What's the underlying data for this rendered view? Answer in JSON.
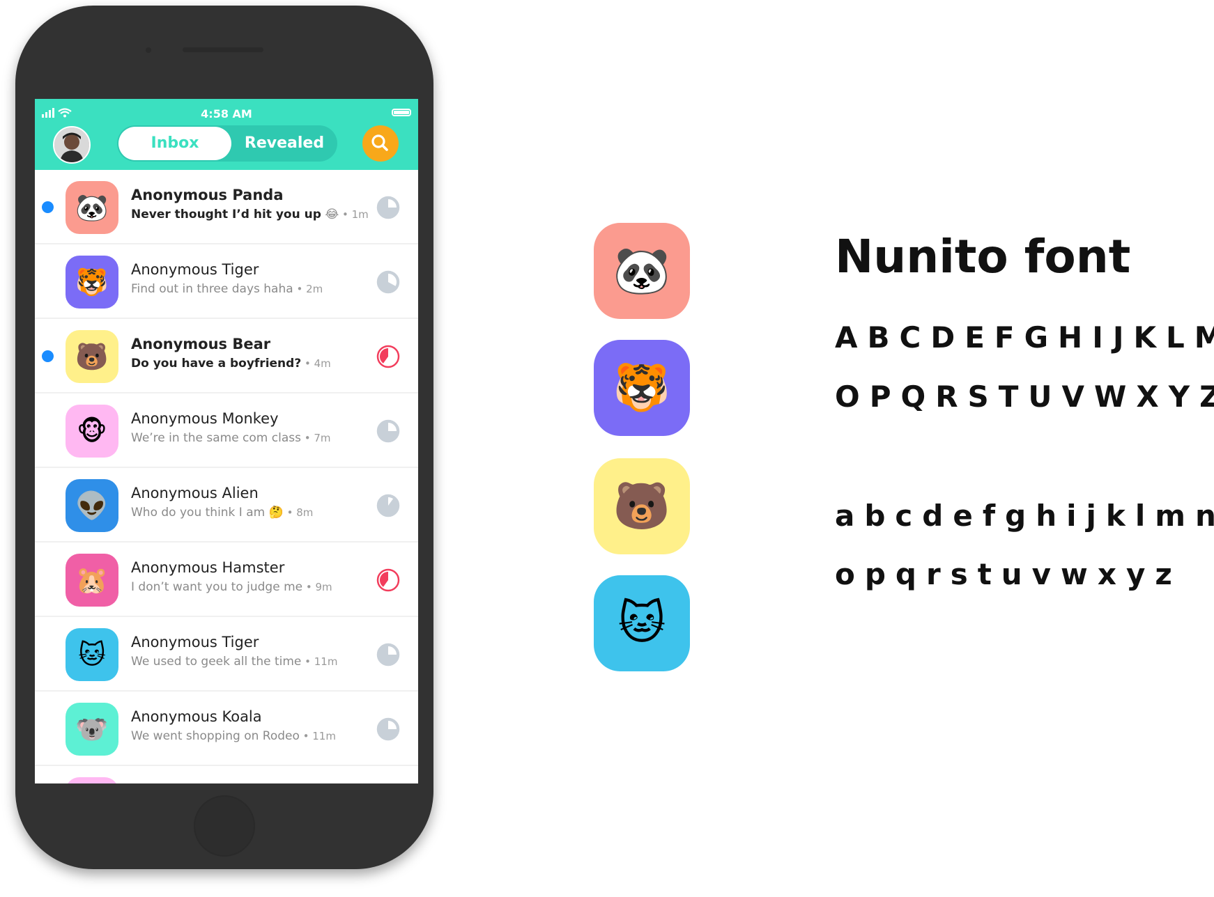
{
  "status_bar": {
    "time": "4:58 AM"
  },
  "header": {
    "tabs": {
      "inbox": "Inbox",
      "revealed": "Revealed"
    }
  },
  "messages": [
    {
      "name": "Anonymous Panda",
      "message": "Never thought I’d hit you up",
      "emoji": "😂",
      "time": "1m",
      "unread": true,
      "icon": "🐼",
      "icon_bg": "#fb9b8f",
      "timer_color": "#c8d0d8",
      "timer_fraction": 0.25
    },
    {
      "name": "Anonymous Tiger",
      "message": "Find out in three days haha",
      "emoji": "",
      "time": "2m",
      "unread": false,
      "icon": "🐯",
      "icon_bg": "#7b6cf6",
      "timer_color": "#c8d0d8",
      "timer_fraction": 0.33
    },
    {
      "name": "Anonymous Bear",
      "message": "Do you have a boyfriend?",
      "emoji": "",
      "time": "4m",
      "unread": true,
      "icon": "🐻",
      "icon_bg": "#fff08a",
      "timer_color": "#f23d5c",
      "timer_fraction": 0.6
    },
    {
      "name": "Anonymous Monkey",
      "message": "We’re in the same com class",
      "emoji": "",
      "time": "7m",
      "unread": false,
      "icon": "🐵",
      "icon_bg": "#ffb8f2",
      "timer_color": "#c8d0d8",
      "timer_fraction": 0.25
    },
    {
      "name": "Anonymous Alien",
      "message": "Who do you think I am",
      "emoji": "🤔",
      "time": "8m",
      "unread": false,
      "icon": "👽",
      "icon_bg": "#2f8fe8",
      "timer_color": "#c8d0d8",
      "timer_fraction": 0.1
    },
    {
      "name": "Anonymous Hamster",
      "message": "I don’t want you to judge me",
      "emoji": "",
      "time": "9m",
      "unread": false,
      "icon": "🐹",
      "icon_bg": "#f05fa6",
      "timer_color": "#f23d5c",
      "timer_fraction": 0.6
    },
    {
      "name": "Anonymous Tiger",
      "message": "We used to geek all the time",
      "emoji": "",
      "time": "11m",
      "unread": false,
      "icon": "🐱",
      "icon_bg": "#3ec3ec",
      "timer_color": "#c8d0d8",
      "timer_fraction": 0.25
    },
    {
      "name": "Anonymous Koala",
      "message": "We went shopping on Rodeo",
      "emoji": "",
      "time": "11m",
      "unread": false,
      "icon": "🐨",
      "icon_bg": "#5df0d4",
      "timer_color": "#c8d0d8",
      "timer_fraction": 0.25
    }
  ],
  "showcase": {
    "icons": [
      {
        "emoji": "🐼",
        "bg": "#fb9b8f"
      },
      {
        "emoji": "🐯",
        "bg": "#7b6cf6"
      },
      {
        "emoji": "🐻",
        "bg": "#fff08a"
      },
      {
        "emoji": "🐱",
        "bg": "#3ec3ec"
      }
    ],
    "font_title": "Nunito font",
    "upper_1": "ABCDEFGHIJKLMN",
    "upper_2": "OPQRSTUVWXYZ",
    "lower_1": "abcdefghijklmn",
    "lower_2": "opqrstuvwxyz"
  }
}
